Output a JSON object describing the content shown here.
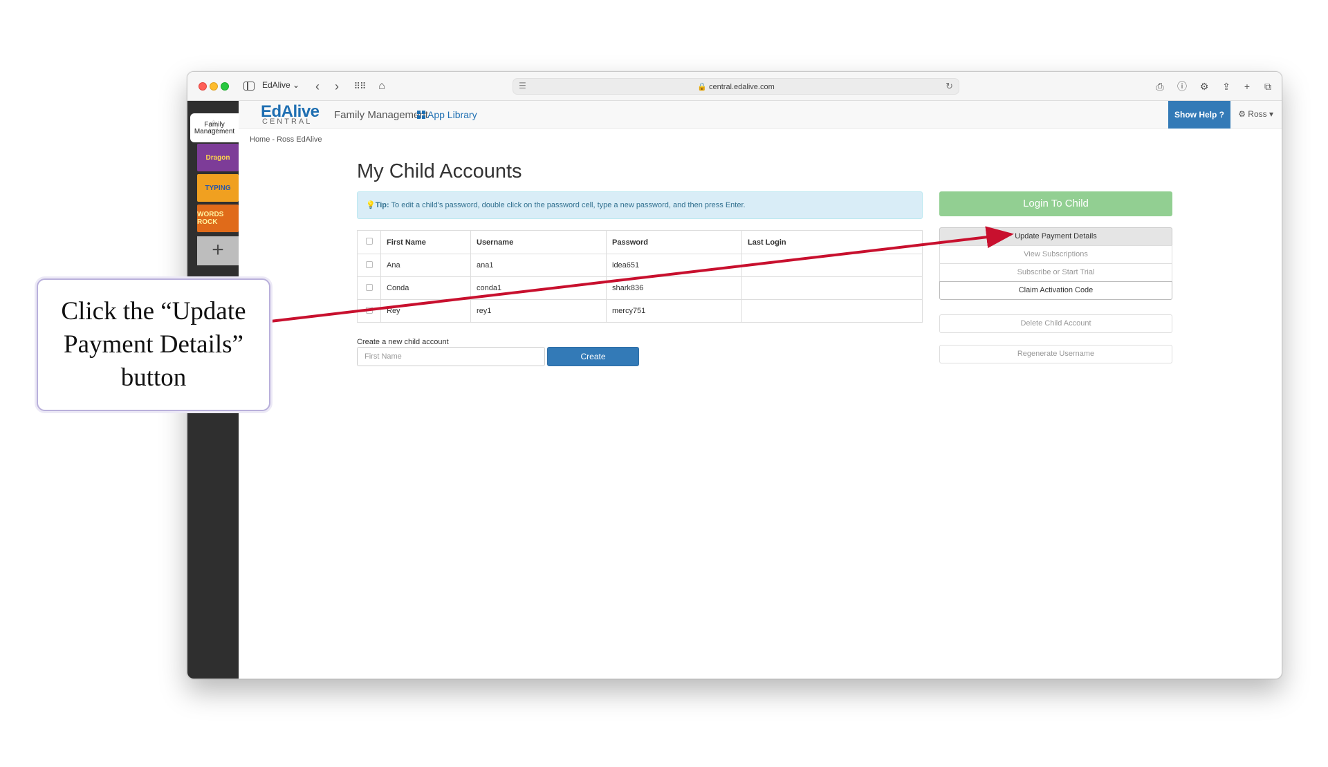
{
  "browser": {
    "tab_name": "EdAlive ⌄",
    "url": "central.edalive.com"
  },
  "sidebar": {
    "family_tile_label": "Family Management",
    "game_tiles": [
      {
        "label": "Dragon",
        "color": "#7d3c98"
      },
      {
        "label": "TYPING",
        "color": "#f0a020"
      },
      {
        "label": "WORDS ROCK",
        "color": "#e06b1a"
      }
    ],
    "add_label": "+"
  },
  "header": {
    "logo_main": "EdAlive",
    "logo_sub": "CENTRAL",
    "family_management": "Family Management",
    "app_library": "App Library",
    "show_help": "Show Help ?",
    "user_menu": "⚙ Ross ▾"
  },
  "breadcrumb": "Home - Ross EdAlive",
  "page": {
    "title": "My Child Accounts",
    "tip_label": "Tip:",
    "tip_text": "To edit a child's password, double click on the password cell, type a new password, and then press Enter."
  },
  "table": {
    "headers": [
      "First Name",
      "Username",
      "Password",
      "Last Login"
    ],
    "rows": [
      {
        "first": "Ana",
        "user": "ana1",
        "pass": "idea651",
        "last": ""
      },
      {
        "first": "Conda",
        "user": "conda1",
        "pass": "shark836",
        "last": ""
      },
      {
        "first": "Rey",
        "user": "rey1",
        "pass": "mercy751",
        "last": ""
      }
    ]
  },
  "create": {
    "label": "Create a new child account",
    "placeholder": "First Name",
    "button": "Create"
  },
  "actions": {
    "login": "Login To Child",
    "update_payment": "Update Payment Details",
    "view_subscriptions": "View Subscriptions",
    "subscribe_trial": "Subscribe or Start Trial",
    "claim_code": "Claim Activation Code",
    "delete_child": "Delete Child Account",
    "regenerate": "Regenerate Username"
  },
  "annotation": {
    "text": "Click the “Update Payment Details” button",
    "arrow_color": "#c8102e"
  }
}
